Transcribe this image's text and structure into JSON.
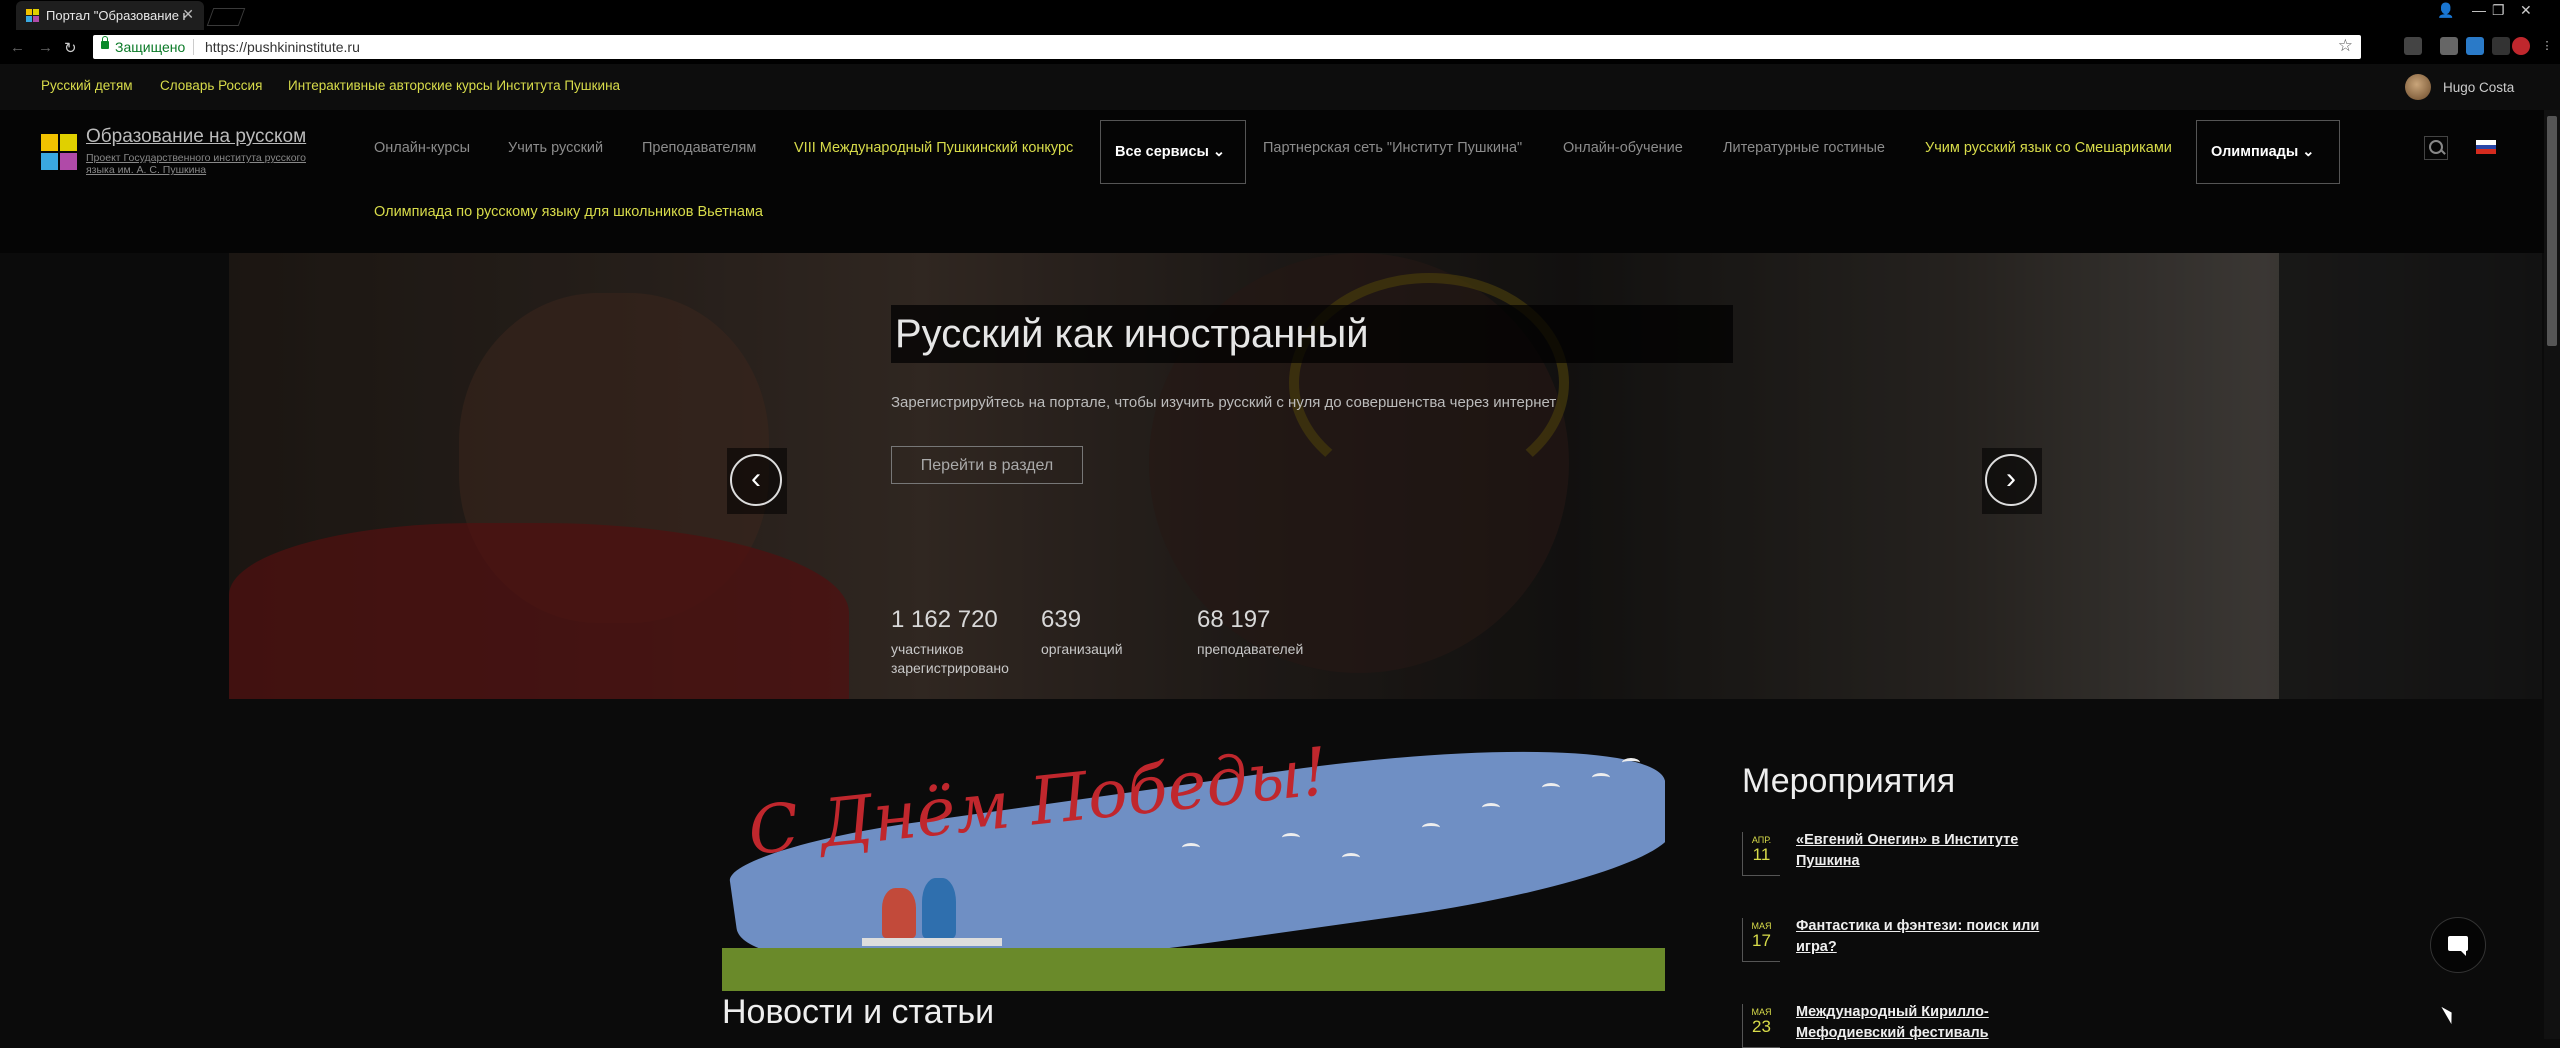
{
  "browser": {
    "tab_title": "Портал \"Образование н",
    "tab_close": "✕",
    "secure_label": "Защищено",
    "url": "https://pushkininstitute.ru",
    "star": "☆",
    "back": "←",
    "forward": "→",
    "reload": "↻",
    "window_controls": [
      "—",
      "❐",
      "✕"
    ]
  },
  "top_links": [
    "Русский детям",
    "Словарь Россия",
    "Интерактивные авторские курсы Института Пушкина"
  ],
  "user": {
    "name": "Hugo Costa"
  },
  "brand": {
    "title": "Образование на русском",
    "subtitle": "Проект Государственного института русского языка им. А. С. Пушкина"
  },
  "nav": {
    "items": [
      "Онлайн-курсы",
      "Учить русский",
      "Преподавателям",
      "VIII Международный Пушкинский конкурс",
      "Все сервисы",
      "Партнерская сеть \"Институт Пушкина\"",
      "Онлайн-обучение",
      "Литературные гостиные",
      "Учим русский язык со Смешариками",
      "Олимпиады",
      "Олимпиада по русскому языку для школьников Вьетнама"
    ]
  },
  "hero": {
    "title": "Русский как иностранный",
    "description": "Зарегистрируйтесь на портале, чтобы изучить русский с нуля до совершенства через интернет",
    "button": "Перейти в раздел",
    "prev": "‹",
    "next": "›",
    "stats": [
      {
        "value": "1 162 720",
        "label": "участников зарегистрировано"
      },
      {
        "value": "639",
        "label": "организаций"
      },
      {
        "value": "68 197",
        "label": "преподавателей"
      }
    ]
  },
  "banner": {
    "text": "С Днём Победы!"
  },
  "news": {
    "title": "Новости и статьи"
  },
  "events": {
    "title": "Мероприятия",
    "items": [
      {
        "month": "АПР.",
        "day": "11",
        "title": "«Евгений Онегин» в Институте Пушкина"
      },
      {
        "month": "МАЯ",
        "day": "17",
        "title": "Фантастика и фэнтези: поиск или игра?"
      },
      {
        "month": "МАЯ",
        "day": "23",
        "title": "Международный Кирилло-Мефодиевский фестиваль"
      }
    ]
  },
  "colors": {
    "accent_yellow": "#d8dc4a",
    "background": "#0b0b0b",
    "logo": [
      "#f2c200",
      "#e0d000",
      "#3aa8e0",
      "#b04aa8"
    ],
    "flag": [
      "#ffffff",
      "#2a47a8",
      "#d52b1e"
    ]
  },
  "icons": [
    "search-icon",
    "chevron-down-icon",
    "chat-icon",
    "lock-icon",
    "star-icon",
    "flag-ru-icon"
  ]
}
